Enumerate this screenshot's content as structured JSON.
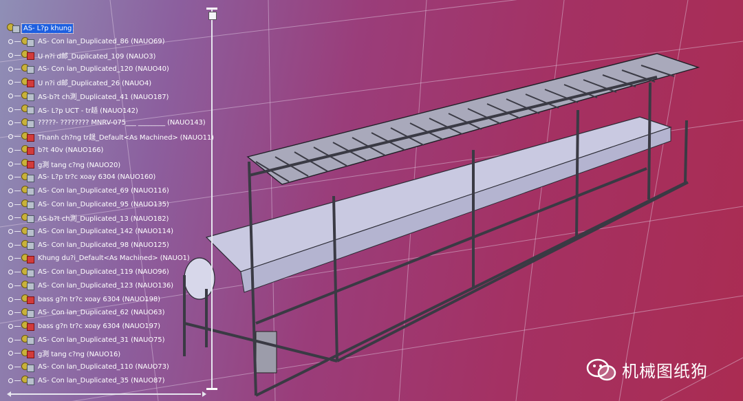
{
  "spec_tree": {
    "nodes": [
      {
        "label": "AS- L?p khung",
        "icon": "assembly-icon",
        "selected": true
      },
      {
        "label": "AS- Con lan_Duplicated_86 (NAUO69)",
        "icon": "assembly-icon"
      },
      {
        "label": "U n?i d邮_Duplicated_109 (NAUO3)",
        "icon": "part-icon"
      },
      {
        "label": "AS- Con lan_Duplicated_120 (NAUO40)",
        "icon": "assembly-icon"
      },
      {
        "label": "U n?i d邮_Duplicated_26 (NAUO4)",
        "icon": "part-icon"
      },
      {
        "label": "AS-b?t ch測_Duplicated_41 (NAUO187)",
        "icon": "assembly-icon"
      },
      {
        "label": "AS- L?p UCT - tr趏 (NAUO142)",
        "icon": "assembly-icon"
      },
      {
        "label": "?????- ???????? MNRV-075___ ________ (NAUO143)",
        "icon": "assembly-icon"
      },
      {
        "label": "Thanh ch?ng tr趧_Default<As Machined> (NAUO11)",
        "icon": "part-icon"
      },
      {
        "label": "b?t 40v (NAUO166)",
        "icon": "part-icon"
      },
      {
        "label": "g測 tang c?ng (NAUO20)",
        "icon": "part-icon"
      },
      {
        "label": "AS- L?p tr?c xoay 6304 (NAUO160)",
        "icon": "assembly-icon"
      },
      {
        "label": "AS- Con lan_Duplicated_69 (NAUO116)",
        "icon": "assembly-icon"
      },
      {
        "label": "AS- Con lan_Duplicated_95 (NAUO135)",
        "icon": "assembly-icon"
      },
      {
        "label": "AS-b?t ch測_Duplicated_13 (NAUO182)",
        "icon": "assembly-icon"
      },
      {
        "label": "AS- Con lan_Duplicated_142 (NAUO114)",
        "icon": "assembly-icon"
      },
      {
        "label": "AS- Con lan_Duplicated_98 (NAUO125)",
        "icon": "assembly-icon"
      },
      {
        "label": "Khung du?i_Default<As Machined> (NAUO1)",
        "icon": "part-icon"
      },
      {
        "label": "AS- Con lan_Duplicated_119 (NAUO96)",
        "icon": "assembly-icon"
      },
      {
        "label": "AS- Con lan_Duplicated_123 (NAUO136)",
        "icon": "assembly-icon"
      },
      {
        "label": "bass g?n tr?c xoay 6304 (NAUO198)",
        "icon": "part-icon"
      },
      {
        "label": "AS- Con lan_Duplicated_62 (NAUO63)",
        "icon": "assembly-icon"
      },
      {
        "label": "bass g?n tr?c xoay 6304 (NAUO197)",
        "icon": "part-icon"
      },
      {
        "label": "AS- Con lan_Duplicated_31 (NAUO75)",
        "icon": "assembly-icon"
      },
      {
        "label": "g測 tang c?ng (NAUO16)",
        "icon": "part-icon"
      },
      {
        "label": "AS- Con lan_Duplicated_110 (NAUO73)",
        "icon": "assembly-icon"
      },
      {
        "label": "AS- Con lan_Duplicated_35 (NAUO87)",
        "icon": "assembly-icon"
      }
    ]
  },
  "watermark": {
    "text": "机械图纸狗",
    "icon": "wechat-icon"
  },
  "colors": {
    "selection": "#1d5fe0",
    "tree_text": "#ffffff",
    "frame": "#3a3a44",
    "belt": "#c8c8e0"
  }
}
